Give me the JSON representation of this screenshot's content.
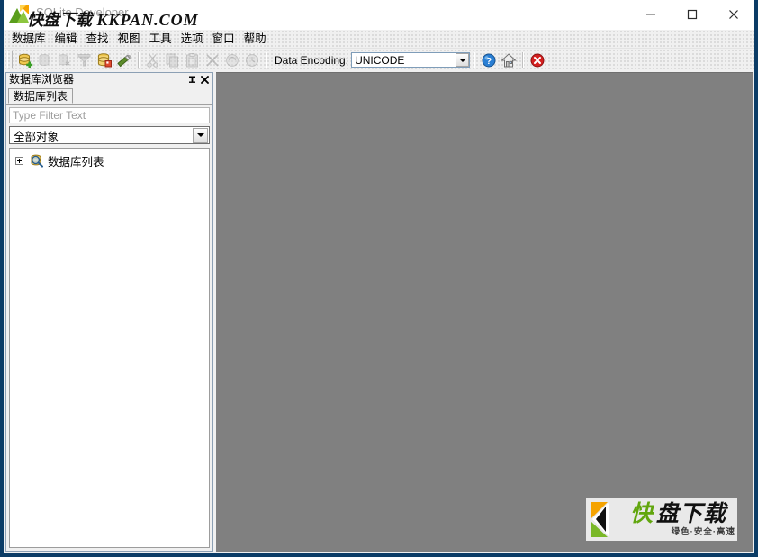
{
  "window": {
    "title": "SQLite Developer",
    "controls": {
      "minimize": "minimize-button",
      "maximize": "maximize-button",
      "close": "close-button"
    }
  },
  "watermark": {
    "title_cn": "快盘下载",
    "title_en": "KKPAN.COM",
    "logo_char": "快",
    "logo_text": "盘下载",
    "logo_sub": "绿色·安全·高速",
    "colors": {
      "green": "#61a60e",
      "orange": "#f5a300",
      "black": "#111111"
    }
  },
  "menubar": {
    "items": [
      {
        "label": "数据库"
      },
      {
        "label": "编辑"
      },
      {
        "label": "查找"
      },
      {
        "label": "视图"
      },
      {
        "label": "工具"
      },
      {
        "label": "选项"
      },
      {
        "label": "窗口"
      },
      {
        "label": "帮助"
      }
    ]
  },
  "toolbar": {
    "group1": [
      {
        "name": "new-database-icon",
        "enabled": true
      },
      {
        "name": "open-database-icon",
        "enabled": false
      },
      {
        "name": "close-database-icon",
        "enabled": false
      },
      {
        "name": "compact-database-icon",
        "enabled": false
      },
      {
        "name": "backup-database-icon",
        "enabled": true
      },
      {
        "name": "edit-sql-icon",
        "enabled": true
      }
    ],
    "group2": [
      {
        "name": "cut-icon",
        "enabled": false
      },
      {
        "name": "copy-icon",
        "enabled": false
      },
      {
        "name": "paste-icon",
        "enabled": false
      },
      {
        "name": "delete-icon",
        "enabled": false
      },
      {
        "name": "undo-icon",
        "enabled": false
      },
      {
        "name": "redo-icon",
        "enabled": false
      }
    ],
    "encoding_label": "Data Encoding:",
    "encoding_value": "UNICODE",
    "group3": [
      {
        "name": "help-icon",
        "enabled": true
      },
      {
        "name": "home-icon",
        "enabled": true
      },
      {
        "name": "stop-icon",
        "enabled": true
      }
    ]
  },
  "panel": {
    "title": "数据库浏览器",
    "pin_label": "⊥",
    "close_label": "✕",
    "tabs": [
      {
        "label": "数据库列表",
        "active": true
      }
    ],
    "filter_placeholder": "Type Filter Text",
    "filter_value": "",
    "object_filter": {
      "selected": "全部对象"
    },
    "tree": [
      {
        "label": "数据库列表",
        "icon": "database-search-icon",
        "expanded": false
      }
    ]
  },
  "mdi": {
    "background_color": "#808080"
  }
}
